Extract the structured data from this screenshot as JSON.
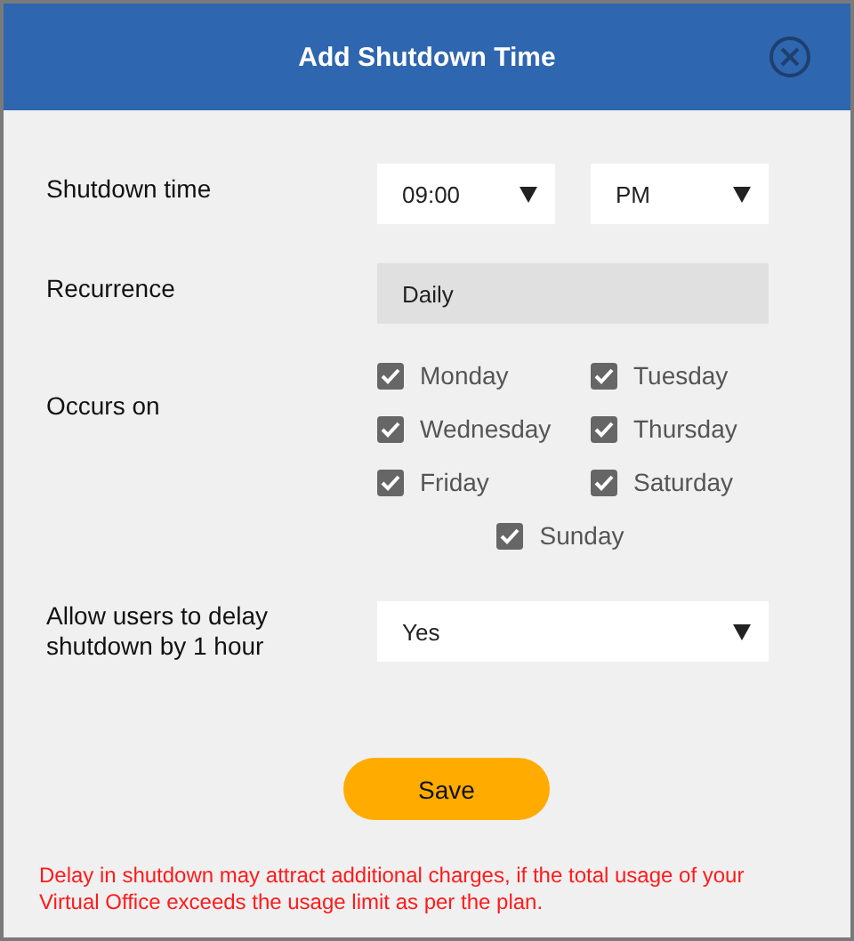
{
  "dialog": {
    "title": "Add Shutdown Time"
  },
  "shutdown_time": {
    "label": "Shutdown time",
    "time": "09:00",
    "period": "PM"
  },
  "recurrence": {
    "label": "Recurrence",
    "value": "Daily"
  },
  "occurs_on": {
    "label": "Occurs on",
    "days": [
      {
        "label": "Monday",
        "checked": true
      },
      {
        "label": "Tuesday",
        "checked": true
      },
      {
        "label": "Wednesday",
        "checked": true
      },
      {
        "label": "Thursday",
        "checked": true
      },
      {
        "label": "Friday",
        "checked": true
      },
      {
        "label": "Saturday",
        "checked": true
      },
      {
        "label": "Sunday",
        "checked": true
      }
    ]
  },
  "delay": {
    "label": "Allow users to delay shutdown by 1 hour",
    "value": "Yes"
  },
  "save_button": "Save",
  "note": "Delay in shutdown may attract additional charges, if the total usage of your Virtual Office exceeds the usage limit as per the plan."
}
